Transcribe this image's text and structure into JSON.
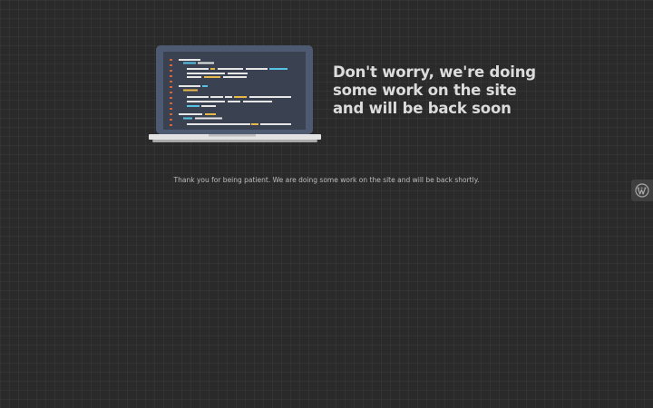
{
  "headline": "Don't worry, we're doing some work on the site and will be back soon",
  "message": "Thank you for being patient. We are doing some work on the site and will be back shortly.",
  "colors": {
    "background": "#2a2a2a",
    "laptop_frame": "#4d5a72",
    "screen": "#3a4150",
    "headline_text": "#dcdcdc",
    "message_text": "#bcbcbc"
  },
  "icons": {
    "laptop": "laptop-code-illustration",
    "wordpress": "wordpress-logo-icon"
  }
}
